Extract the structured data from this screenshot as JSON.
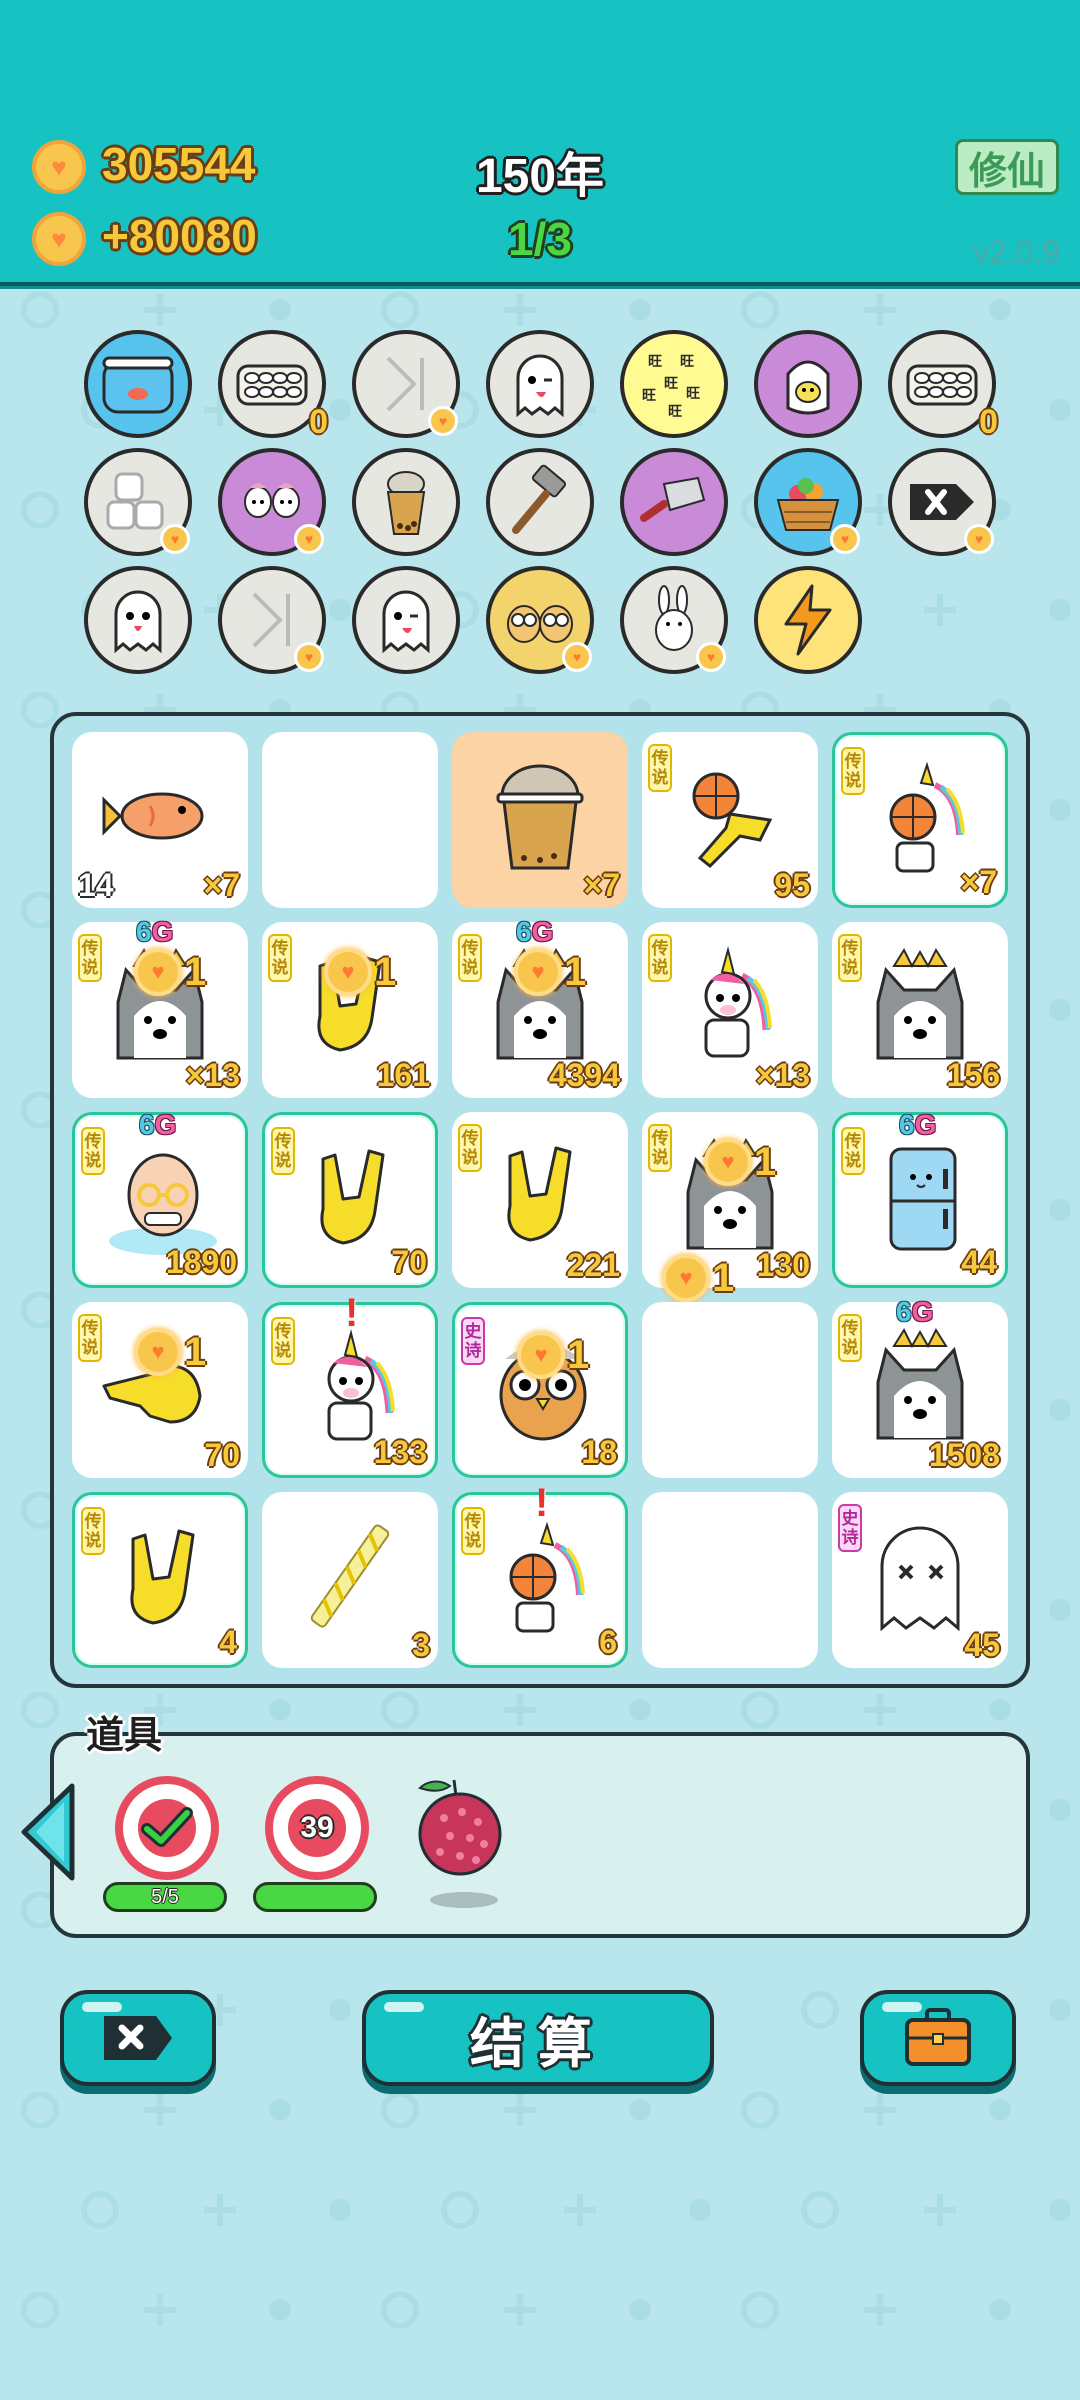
{
  "header": {
    "coins": "305544",
    "income": "+80080",
    "year": "150年",
    "progress": "1/3",
    "cultivate_label": "修仙",
    "version": "v2.0.9"
  },
  "buffs": [
    {
      "icon": "fishbowl-icon",
      "count": null
    },
    {
      "icon": "egg-tray-icon",
      "count": "0"
    },
    {
      "icon": "skip-icon",
      "count": null
    },
    {
      "icon": "ghost-wink-icon",
      "count": null
    },
    {
      "icon": "wang-tiles-icon",
      "count": null
    },
    {
      "icon": "egg-bag-icon",
      "count": null
    },
    {
      "icon": "egg-tray-icon",
      "count": "0"
    },
    {
      "icon": "dice-icon",
      "count": null
    },
    {
      "icon": "unicorn-pair-icon",
      "count": null
    },
    {
      "icon": "bubble-tea-icon",
      "count": null
    },
    {
      "icon": "hammer-icon",
      "count": null
    },
    {
      "icon": "cleaver-icon",
      "count": null
    },
    {
      "icon": "fruit-basket-icon",
      "count": null
    },
    {
      "icon": "delete-icon",
      "count": null
    },
    {
      "icon": "ghost-icon",
      "count": null
    },
    {
      "icon": "skip-icon",
      "count": null
    },
    {
      "icon": "ghost-wink-icon",
      "count": null
    },
    {
      "icon": "owl-pair-icon",
      "count": null
    },
    {
      "icon": "bunny-icon",
      "count": null
    },
    {
      "icon": "lightning-icon",
      "count": null
    }
  ],
  "board": {
    "cells": [
      {
        "art": "fish",
        "left": "14",
        "num": "×7",
        "tag": "",
        "sixg": false,
        "hl": false
      },
      {
        "art": "",
        "left": "",
        "num": "",
        "tag": "",
        "sixg": false,
        "hl": false
      },
      {
        "art": "cup",
        "left": "",
        "num": "×7",
        "tag": "",
        "sixg": false,
        "hl": false,
        "orange": true
      },
      {
        "art": "basketball-hand",
        "left": "",
        "num": "95",
        "tag": "传说",
        "sixg": false,
        "hl": false
      },
      {
        "art": "unicorn-ball",
        "left": "",
        "num": "×7",
        "tag": "传说",
        "sixg": false,
        "hl": true
      },
      {
        "art": "husky",
        "left": "",
        "num": "×13",
        "tag": "传说",
        "sixg": true,
        "hl": false,
        "bubble": "1"
      },
      {
        "art": "rock-hand",
        "left": "",
        "num": "161",
        "tag": "传说",
        "sixg": false,
        "hl": false,
        "bubble": "1"
      },
      {
        "art": "husky",
        "left": "",
        "num": "4394",
        "tag": "传说",
        "sixg": true,
        "hl": false,
        "bubble": "1"
      },
      {
        "art": "unicorn",
        "left": "",
        "num": "×13",
        "tag": "传说",
        "sixg": false,
        "hl": false
      },
      {
        "art": "husky",
        "left": "",
        "num": "156",
        "tag": "传说",
        "sixg": false,
        "hl": false
      },
      {
        "art": "bald-man",
        "left": "",
        "num": "1890",
        "tag": "传说",
        "sixg": true,
        "hl": true
      },
      {
        "art": "rock-hand",
        "left": "",
        "num": "70",
        "tag": "传说",
        "sixg": false,
        "hl": true
      },
      {
        "art": "rock-hand",
        "left": "",
        "num": "221",
        "tag": "传说",
        "sixg": false,
        "hl": false
      },
      {
        "art": "husky",
        "left": "",
        "num": "130",
        "tag": "传说",
        "sixg": false,
        "hl": false,
        "bubble": "1",
        "bubble2": "1"
      },
      {
        "art": "fridge",
        "left": "",
        "num": "44",
        "tag": "传说",
        "sixg": true,
        "hl": true
      },
      {
        "art": "point-hand",
        "left": "",
        "num": "70",
        "tag": "传说",
        "sixg": false,
        "hl": false,
        "bubble": "1"
      },
      {
        "art": "unicorn",
        "left": "",
        "num": "133",
        "tag": "传说",
        "sixg": false,
        "hl": true,
        "excl": true
      },
      {
        "art": "owl",
        "left": "",
        "num": "18",
        "tag": "史诗",
        "sixg": false,
        "hl": true,
        "bubble": "1"
      },
      {
        "art": "",
        "left": "",
        "num": "",
        "tag": "",
        "sixg": false,
        "hl": false
      },
      {
        "art": "husky",
        "left": "",
        "num": "1508",
        "tag": "传说",
        "sixg": true,
        "hl": false
      },
      {
        "art": "rock-hand",
        "left": "",
        "num": "4",
        "tag": "传说",
        "sixg": false,
        "hl": true
      },
      {
        "art": "straw",
        "left": "",
        "num": "3",
        "tag": "",
        "sixg": false,
        "hl": false
      },
      {
        "art": "unicorn-ball",
        "left": "",
        "num": "6",
        "tag": "传说",
        "sixg": false,
        "hl": true,
        "excl": true
      },
      {
        "art": "",
        "left": "",
        "num": "",
        "tag": "",
        "sixg": false,
        "hl": false
      },
      {
        "art": "ghost-dead",
        "left": "",
        "num": "45",
        "tag": "史诗",
        "sixg": false,
        "hl": false
      }
    ],
    "sixg_six": "6",
    "sixg_g": "G"
  },
  "items": {
    "title": "道具",
    "target_count": "5/5",
    "target2_value": "39",
    "target2_level": 1.0,
    "fruit": "lychee-icon"
  },
  "buttons": {
    "discard_icon": "delete-icon",
    "settle_label": "结算",
    "bag_icon": "briefcase-icon"
  }
}
